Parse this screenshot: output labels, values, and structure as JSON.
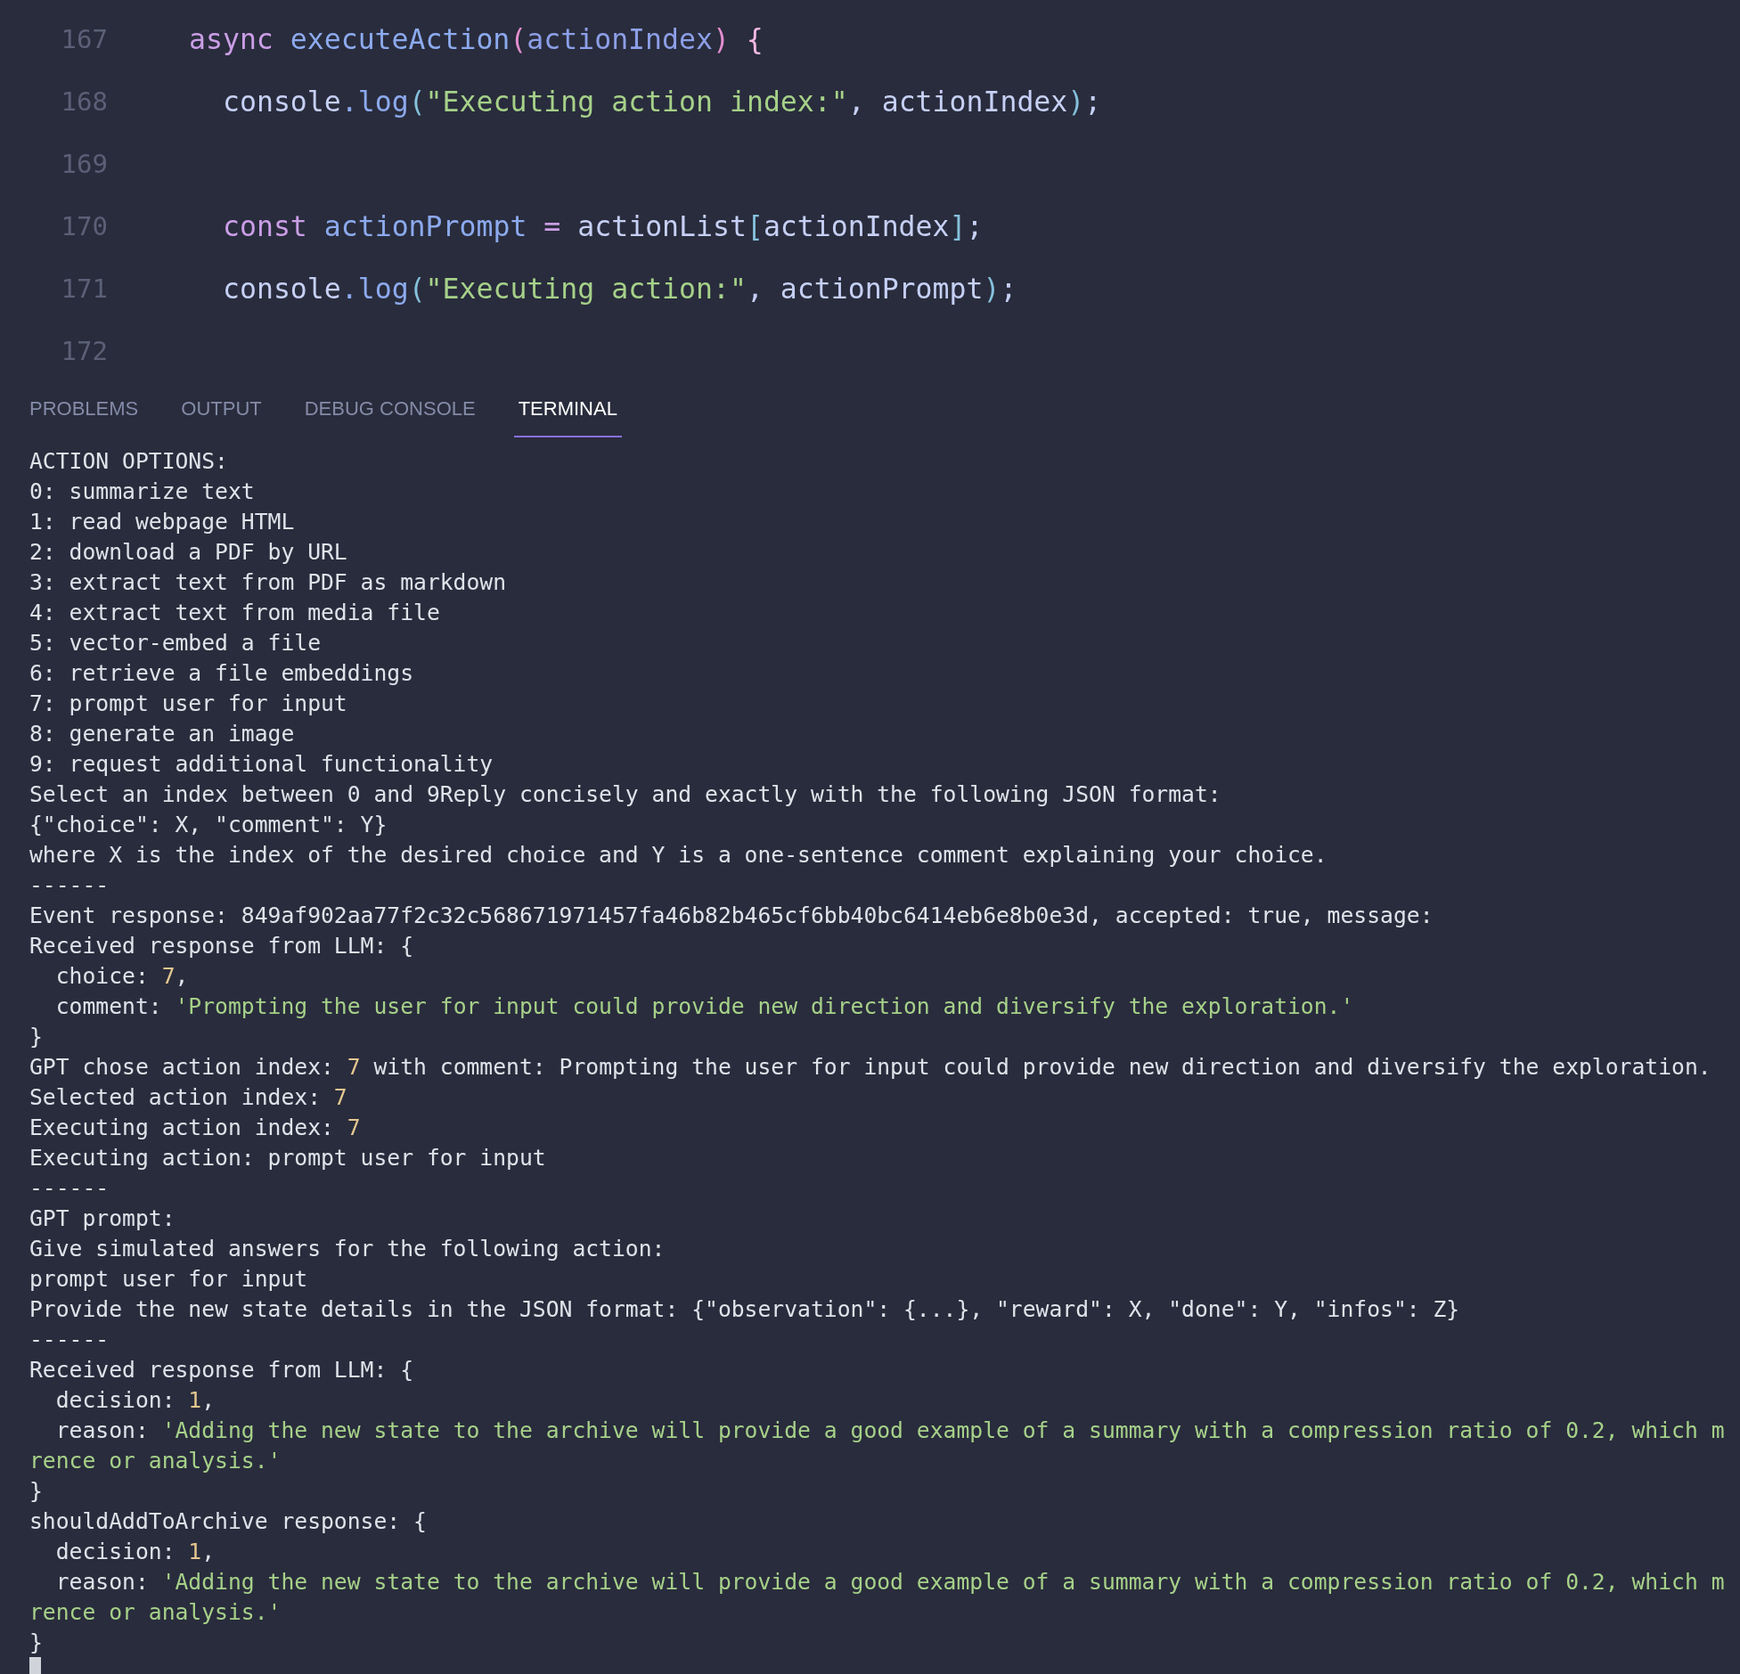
{
  "code_lines": [
    {
      "number": "167",
      "tokens": [
        {
          "kind": "keyword",
          "text": "async "
        },
        {
          "kind": "function",
          "text": "executeAction"
        },
        {
          "kind": "paren",
          "text": "("
        },
        {
          "kind": "param",
          "text": "actionIndex"
        },
        {
          "kind": "paren",
          "text": ")"
        },
        {
          "kind": "brace",
          "text": " {"
        }
      ],
      "children": [
        {
          "number": "168",
          "tokens": [
            {
              "kind": "plain",
              "text": "console"
            },
            {
              "kind": "punct",
              "text": "."
            },
            {
              "kind": "function",
              "text": "log"
            },
            {
              "kind": "bracket",
              "text": "("
            },
            {
              "kind": "string",
              "text": "\"Executing action index:\""
            },
            {
              "kind": "plain",
              "text": ", actionIndex"
            },
            {
              "kind": "bracket",
              "text": ")"
            },
            {
              "kind": "plain",
              "text": ";"
            }
          ]
        },
        {
          "number": "169"
        },
        {
          "number": "170",
          "tokens": [
            {
              "kind": "keyword",
              "text": "const "
            },
            {
              "kind": "function",
              "text": "actionPrompt "
            },
            {
              "kind": "operator",
              "text": "="
            },
            {
              "kind": "plain",
              "text": " actionList"
            },
            {
              "kind": "bracket",
              "text": "["
            },
            {
              "kind": "plain",
              "text": "actionIndex"
            },
            {
              "kind": "bracket",
              "text": "]"
            },
            {
              "kind": "plain",
              "text": ";"
            }
          ]
        },
        {
          "number": "171",
          "tokens": [
            {
              "kind": "plain",
              "text": "console"
            },
            {
              "kind": "punct",
              "text": "."
            },
            {
              "kind": "function",
              "text": "log"
            },
            {
              "kind": "bracket",
              "text": "("
            },
            {
              "kind": "string",
              "text": "\"Executing action:\""
            },
            {
              "kind": "plain",
              "text": ", actionPrompt"
            },
            {
              "kind": "bracket",
              "text": ")"
            },
            {
              "kind": "plain",
              "text": ";"
            }
          ]
        },
        {
          "number": "172"
        }
      ]
    }
  ],
  "tabs": [
    {
      "label": "PROBLEMS",
      "selected": false
    },
    {
      "label": "OUTPUT",
      "selected": false
    },
    {
      "label": "DEBUG CONSOLE",
      "selected": false
    },
    {
      "label": "TERMINAL",
      "selected": true
    }
  ],
  "terminal_lines": [
    {
      "parts": [
        {
          "kind": "plain",
          "text": "ACTION OPTIONS:"
        }
      ]
    },
    {
      "parts": [
        {
          "kind": "plain",
          "text": "0: summarize text"
        }
      ]
    },
    {
      "parts": [
        {
          "kind": "plain",
          "text": "1: read webpage HTML"
        }
      ]
    },
    {
      "parts": [
        {
          "kind": "plain",
          "text": "2: download a PDF by URL"
        }
      ]
    },
    {
      "parts": [
        {
          "kind": "plain",
          "text": "3: extract text from PDF as markdown"
        }
      ]
    },
    {
      "parts": [
        {
          "kind": "plain",
          "text": "4: extract text from media file"
        }
      ]
    },
    {
      "parts": [
        {
          "kind": "plain",
          "text": "5: vector-embed a file"
        }
      ]
    },
    {
      "parts": [
        {
          "kind": "plain",
          "text": "6: retrieve a file embeddings"
        }
      ]
    },
    {
      "parts": [
        {
          "kind": "plain",
          "text": "7: prompt user for input"
        }
      ]
    },
    {
      "parts": [
        {
          "kind": "plain",
          "text": "8: generate an image"
        }
      ]
    },
    {
      "parts": [
        {
          "kind": "plain",
          "text": "9: request additional functionality"
        }
      ]
    },
    {
      "parts": [
        {
          "kind": "plain",
          "text": "Select an index between 0 and 9Reply concisely and exactly with the following JSON format:"
        }
      ]
    },
    {
      "parts": [
        {
          "kind": "plain",
          "text": "{\"choice\": X, \"comment\": Y}"
        }
      ]
    },
    {
      "parts": [
        {
          "kind": "plain",
          "text": "where X is the index of the desired choice and Y is a one-sentence comment explaining your choice."
        }
      ]
    },
    {
      "parts": [
        {
          "kind": "plain",
          "text": "------"
        }
      ]
    },
    {
      "parts": [
        {
          "kind": "plain",
          "text": "Event response: 849af902aa77f2c32c568671971457fa46b82b465cf6bb40bc6414eb6e8b0e3d, accepted: true, message:"
        }
      ]
    },
    {
      "parts": [
        {
          "kind": "plain",
          "text": "Received response from LLM: {"
        }
      ]
    },
    {
      "parts": [
        {
          "kind": "plain",
          "text": "  choice: "
        },
        {
          "kind": "number",
          "text": "7"
        },
        {
          "kind": "plain",
          "text": ","
        }
      ]
    },
    {
      "parts": [
        {
          "kind": "plain",
          "text": "  comment: "
        },
        {
          "kind": "string",
          "text": "'Prompting the user for input could provide new direction and diversify the exploration.'"
        }
      ]
    },
    {
      "parts": [
        {
          "kind": "plain",
          "text": "}"
        }
      ]
    },
    {
      "parts": [
        {
          "kind": "plain",
          "text": "GPT chose action index: "
        },
        {
          "kind": "number",
          "text": "7"
        },
        {
          "kind": "plain",
          "text": " with comment: Prompting the user for input could provide new direction and diversify the exploration."
        }
      ]
    },
    {
      "parts": [
        {
          "kind": "plain",
          "text": "Selected action index: "
        },
        {
          "kind": "number",
          "text": "7"
        }
      ]
    },
    {
      "parts": [
        {
          "kind": "plain",
          "text": "Executing action index: "
        },
        {
          "kind": "number",
          "text": "7"
        }
      ]
    },
    {
      "parts": [
        {
          "kind": "plain",
          "text": "Executing action: prompt user for input"
        }
      ]
    },
    {
      "parts": [
        {
          "kind": "plain",
          "text": "------"
        }
      ]
    },
    {
      "parts": [
        {
          "kind": "plain",
          "text": "GPT prompt:"
        }
      ]
    },
    {
      "parts": [
        {
          "kind": "plain",
          "text": "Give simulated answers for the following action:"
        }
      ]
    },
    {
      "parts": [
        {
          "kind": "plain",
          "text": "prompt user for input"
        }
      ]
    },
    {
      "parts": [
        {
          "kind": "plain",
          "text": "Provide the new state details in the JSON format: {\"observation\": {...}, \"reward\": X, \"done\": Y, \"infos\": Z}"
        }
      ]
    },
    {
      "parts": [
        {
          "kind": "plain",
          "text": "------"
        }
      ]
    },
    {
      "parts": [
        {
          "kind": "plain",
          "text": "Received response from LLM: {"
        }
      ]
    },
    {
      "parts": [
        {
          "kind": "plain",
          "text": "  decision: "
        },
        {
          "kind": "number",
          "text": "1"
        },
        {
          "kind": "plain",
          "text": ","
        }
      ]
    },
    {
      "parts": [
        {
          "kind": "plain",
          "text": "  reason: "
        },
        {
          "kind": "string",
          "text": "'Adding the new state to the archive will provide a good example of a summary with a compression ratio of 0.2, which m"
        }
      ]
    },
    {
      "parts": [
        {
          "kind": "string",
          "text": "rence or analysis.'"
        }
      ]
    },
    {
      "parts": [
        {
          "kind": "plain",
          "text": "}"
        }
      ]
    },
    {
      "parts": [
        {
          "kind": "plain",
          "text": "shouldAddToArchive response: {"
        }
      ]
    },
    {
      "parts": [
        {
          "kind": "plain",
          "text": "  decision: "
        },
        {
          "kind": "number",
          "text": "1"
        },
        {
          "kind": "plain",
          "text": ","
        }
      ]
    },
    {
      "parts": [
        {
          "kind": "plain",
          "text": "  reason: "
        },
        {
          "kind": "string",
          "text": "'Adding the new state to the archive will provide a good example of a summary with a compression ratio of 0.2, which m"
        }
      ]
    },
    {
      "parts": [
        {
          "kind": "string",
          "text": "rence or analysis.'"
        }
      ]
    },
    {
      "parts": [
        {
          "kind": "plain",
          "text": "}"
        }
      ]
    }
  ]
}
